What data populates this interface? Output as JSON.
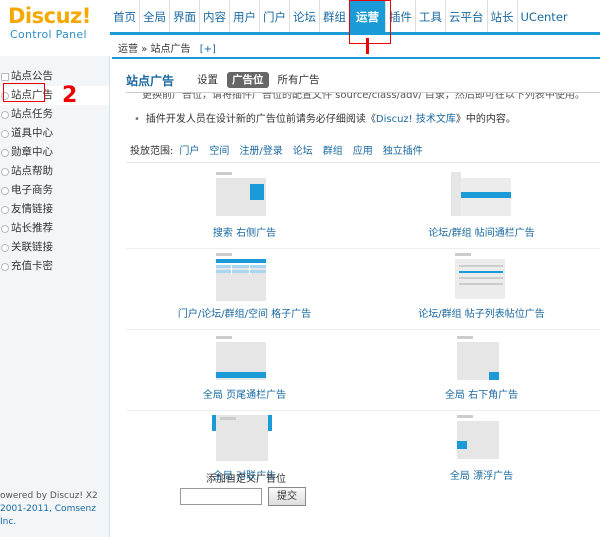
{
  "logo": {
    "brand": "Discuz!",
    "subtitle": "Control Panel"
  },
  "nav": {
    "items": [
      "首页",
      "全局",
      "界面",
      "内容",
      "用户",
      "门户",
      "论坛",
      "群组",
      "运营",
      "插件",
      "工具",
      "云平台",
      "站长",
      "UCenter"
    ],
    "active": "运营"
  },
  "annotations": {
    "one": "1",
    "two": "2"
  },
  "breadcrumb": {
    "parent": "运营",
    "sep": "»",
    "current": "站点广告",
    "add": "[+]"
  },
  "sidebar": {
    "items": [
      "站点公告",
      "站点广告",
      "站点任务",
      "道具中心",
      "勋章中心",
      "站点帮助",
      "电子商务",
      "友情链接",
      "站长推荐",
      "关联链接",
      "充值卡密"
    ],
    "active": "站点广告",
    "footer_line1": "owered by Discuz! X2",
    "footer_line2": "2001-2011, Comsenz Inc."
  },
  "page": {
    "title": "站点广告",
    "tabs": [
      "设置",
      "广告位",
      "所有广告"
    ],
    "active_tab": "广告位",
    "tip_cut": "更换前广告位，请将插件广告位的配置文件 source/class/adv/ 目录，然后即可在以下列表中使用。",
    "tip_prefix": "插件开发人员在设计新的广告位前请务必仔细阅读《",
    "tip_link": "Discuz! 技术文库",
    "tip_suffix": "》中的内容。",
    "scope_label": "投放范围:",
    "scopes": [
      "门户",
      "空间",
      "注册/登录",
      "论坛",
      "群组",
      "应用",
      "独立插件"
    ],
    "ads": [
      {
        "left": "搜索 右侧广告",
        "right": "论坛/群组 帖间通栏广告"
      },
      {
        "left": "门户/论坛/群组/空间 格子广告",
        "right": "论坛/群组 帖子列表帖位广告"
      },
      {
        "left": "全局 页尾通栏广告",
        "right": "全局 右下角广告"
      },
      {
        "left": "全局 对联广告",
        "right": "全局 漂浮广告"
      }
    ],
    "custom_label": "添加自定义广告位",
    "custom_placeholder": "",
    "submit_label": "提交"
  },
  "colors": {
    "accent": "#1a9ad6",
    "link": "#1a68a0",
    "brand": "#f5a800",
    "annotation": "#e00000"
  }
}
